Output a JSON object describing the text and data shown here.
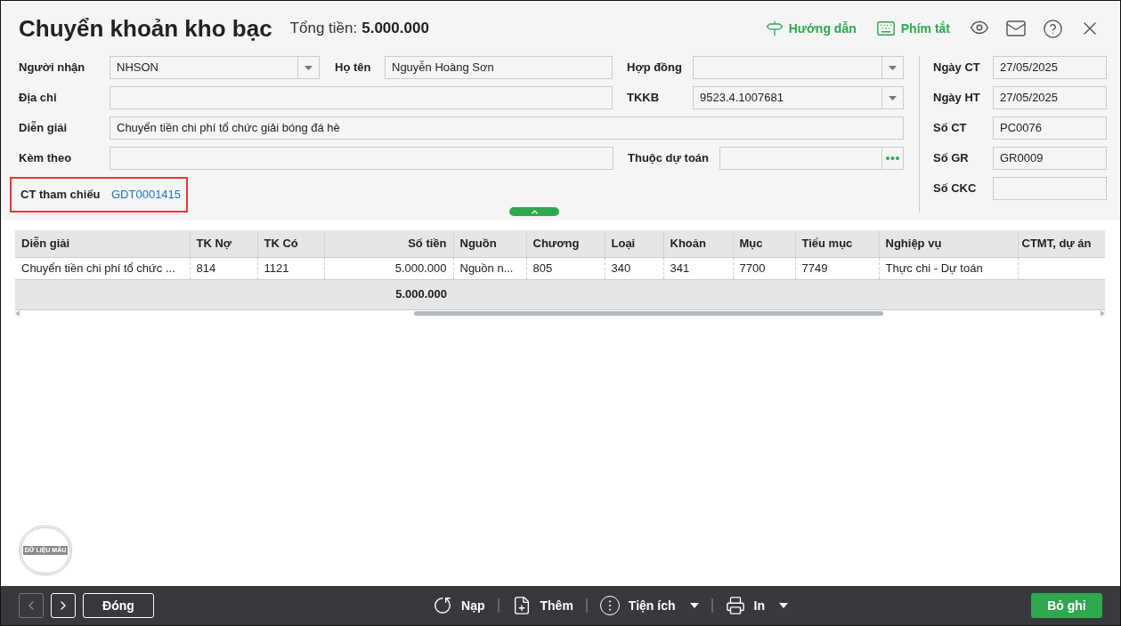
{
  "header": {
    "title": "Chuyển khoản kho bạc",
    "total_label": "Tổng tiền:",
    "total_value": "5.000.000"
  },
  "toolbar_links": [
    {
      "label": "Hướng dẫn"
    },
    {
      "label": "Phím tắt"
    }
  ],
  "form_rows": [
    [
      {
        "label": "Người nhận",
        "value": "NHSON",
        "kind": "dropdown"
      },
      {
        "label": "Họ tên",
        "value": "Nguyễn Hoàng Sơn",
        "kind": "text"
      },
      {
        "label": "Hợp đồng",
        "kind": "dropdown"
      }
    ],
    [
      {
        "label": "Địa chỉ",
        "kind": "text"
      },
      {
        "label": "TKKB",
        "value": "9523.4.1007681",
        "kind": "dropdown"
      }
    ],
    [
      {
        "label": "Diễn giải",
        "value": "Chuyển tiền chi phí tổ chức giải bóng đá hè",
        "kind": "text"
      }
    ],
    [
      {
        "label": "Kèm theo",
        "kind": "text"
      },
      {
        "label": "Thuộc dự toán",
        "kind": "lookup"
      }
    ]
  ],
  "reference": {
    "label": "CT tham chiếu",
    "value": "GDT0001415",
    "highlighted": true
  },
  "side_fields": [
    {
      "label": "Ngày CT",
      "value": "27/05/2025"
    },
    {
      "label": "Ngày HT",
      "value": "27/05/2025"
    },
    {
      "label": "Số CT",
      "value": "PC0076"
    },
    {
      "label": "Số GR",
      "value": "GR0009"
    },
    {
      "label": "Số CKC"
    }
  ],
  "table": {
    "columns": [
      {
        "label": "Diễn giải",
        "kind": "text"
      },
      {
        "label": "TK Nợ",
        "kind": "text"
      },
      {
        "label": "TK Có",
        "kind": "text"
      },
      {
        "label": "Số tiền",
        "kind": "amount"
      },
      {
        "label": "Nguồn",
        "kind": "text"
      },
      {
        "label": "Chương",
        "kind": "text"
      },
      {
        "label": "Loại",
        "kind": "text"
      },
      {
        "label": "Khoản",
        "kind": "text"
      },
      {
        "label": "Mục",
        "kind": "text"
      },
      {
        "label": "Tiểu mục",
        "kind": "text"
      },
      {
        "label": "Nghiệp vụ",
        "kind": "text"
      },
      {
        "label": "CTMT, dự án",
        "kind": "text"
      }
    ],
    "rows": [
      [
        "Chuyển tiền chi phí tổ chức ...",
        "814",
        "1121",
        "5.000.000",
        "Nguồn n...",
        "805",
        "340",
        "341",
        "7700",
        "7749",
        "Thực chi - Dự toán"
      ]
    ],
    "total_amount": "5.000.000"
  },
  "stamp": {
    "text": "DỮ LIỆU MẪU"
  },
  "footer": {
    "nav": [
      {
        "kind": "prev",
        "disabled": true
      },
      {
        "kind": "next",
        "disabled": false
      }
    ],
    "close": "Đóng",
    "actions": [
      {
        "label": "Nạp",
        "kind": "reload",
        "menu": false
      },
      {
        "label": "Thêm",
        "kind": "add",
        "menu": false
      },
      {
        "label": "Tiện ích",
        "kind": "utility",
        "menu": true
      },
      {
        "label": "In",
        "kind": "print",
        "menu": true
      }
    ],
    "save": "Bỏ ghi"
  }
}
